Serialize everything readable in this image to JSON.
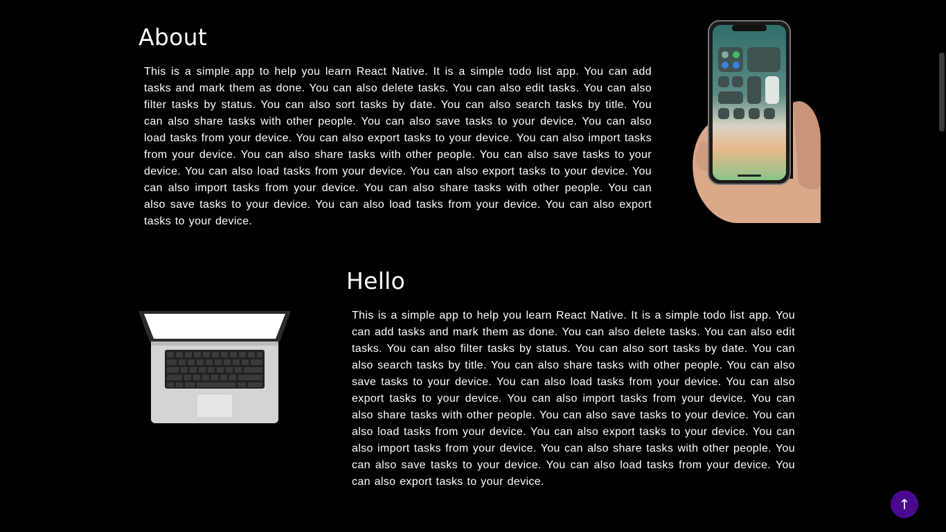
{
  "about": {
    "heading": "About",
    "text": "This is a simple app to help you learn React Native. It is a simple todo list app. You can add tasks and mark them as done. You can also delete tasks. You can also edit tasks. You can also filter tasks by status. You can also sort tasks by date. You can also search tasks by title. You can also share tasks with other people. You can also save tasks to your device. You can also load tasks from your device. You can also export tasks to your device. You can also import tasks from your device. You can also share tasks with other people. You can also save tasks to your device. You can also load tasks from your device. You can also export tasks to your device. You can also import tasks from your device. You can also share tasks with other people. You can also save tasks to your device. You can also load tasks from your device. You can also export tasks to your device.",
    "image_icon": "phone-in-hand-icon"
  },
  "hello": {
    "heading": "Hello",
    "text": "This is a simple app to help you learn React Native. It is a simple todo list app. You can add tasks and mark them as done. You can also delete tasks. You can also edit tasks. You can also filter tasks by status. You can also sort tasks by date. You can also search tasks by title. You can also share tasks with other people. You can also save tasks to your device. You can also load tasks from your device. You can also export tasks to your device. You can also import tasks from your device. You can also share tasks with other people. You can also save tasks to your device. You can also load tasks from your device. You can also export tasks to your device. You can also import tasks from your device. You can also share tasks with other people. You can also save tasks to your device. You can also load tasks from your device. You can also export tasks to your device.",
    "image_icon": "laptop-icon"
  },
  "back_to_top": {
    "glyph": "↑",
    "color": "#4a0a8f"
  },
  "colors": {
    "background": "#000000",
    "text": "#ffffff"
  }
}
